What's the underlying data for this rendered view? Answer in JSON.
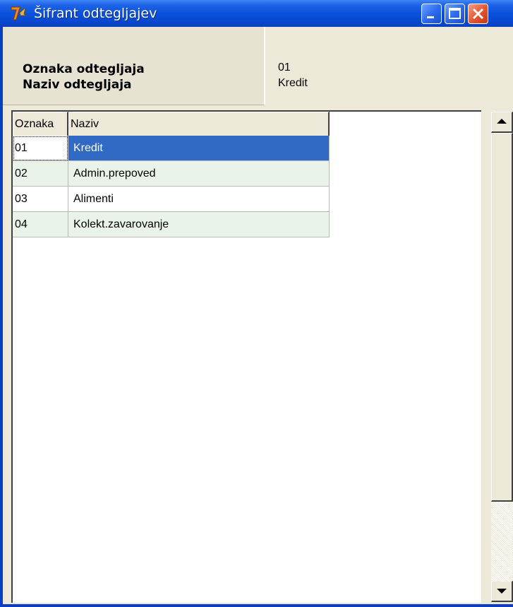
{
  "window": {
    "title": "Šifrant odtegljajev",
    "icon": "app-7-icon",
    "controls": [
      "minimize-icon",
      "maximize-icon",
      "close-icon"
    ]
  },
  "header": {
    "labels": [
      "Oznaka odtegljaja",
      "Naziv odtegljaja"
    ],
    "values": [
      "01",
      "Kredit"
    ]
  },
  "grid": {
    "columns": [
      "Oznaka",
      "Naziv"
    ],
    "rows": [
      {
        "code": "01",
        "name": "Kredit"
      },
      {
        "code": "02",
        "name": "Admin.prepoved"
      },
      {
        "code": "03",
        "name": "Alimenti"
      },
      {
        "code": "04",
        "name": "Kolekt.zavarovanje"
      }
    ],
    "selected_index": 0
  },
  "colors": {
    "titlebar": "#0a52dc",
    "selection": "#316ac5",
    "alt_row": "#eaf3ea",
    "face": "#ece9d8"
  }
}
